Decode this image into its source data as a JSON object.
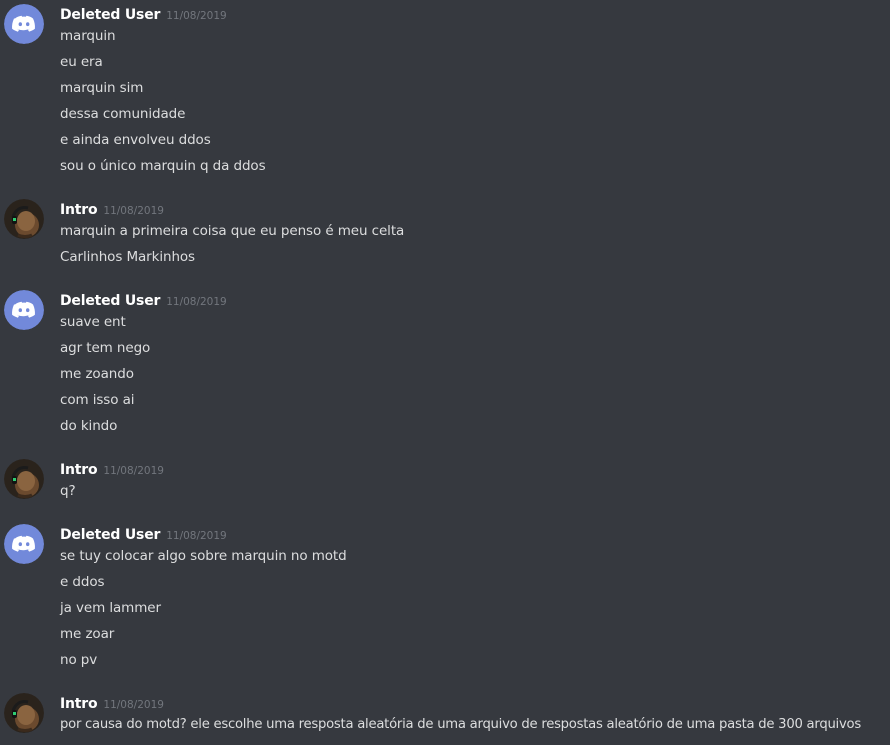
{
  "colors": {
    "background": "#36393f",
    "username": "#ffffff",
    "timestamp": "#72767d",
    "message_text": "#dcddde",
    "default_avatar": "#7289da"
  },
  "messages": [
    {
      "author": "Deleted User",
      "timestamp": "11/08/2019",
      "avatar_icon": "discord-default-avatar-icon",
      "lines": [
        "marquin",
        "eu era",
        "marquin sim",
        "dessa comunidade",
        "e ainda envolveu ddos",
        "sou o único marquin q da ddos"
      ]
    },
    {
      "author": "Intro",
      "timestamp": "11/08/2019",
      "avatar_icon": "user-photo-avatar",
      "lines": [
        "marquin a primeira coisa que eu penso é meu celta",
        "Carlinhos Markinhos"
      ]
    },
    {
      "author": "Deleted User",
      "timestamp": "11/08/2019",
      "avatar_icon": "discord-default-avatar-icon",
      "lines": [
        "suave ent",
        "agr tem nego",
        "me zoando",
        "com isso ai",
        "do kindo"
      ]
    },
    {
      "author": "Intro",
      "timestamp": "11/08/2019",
      "avatar_icon": "user-photo-avatar",
      "lines": [
        "q?"
      ]
    },
    {
      "author": "Deleted User",
      "timestamp": "11/08/2019",
      "avatar_icon": "discord-default-avatar-icon",
      "lines": [
        "se tuy colocar algo sobre marquin no motd",
        "e ddos",
        "ja vem lammer",
        "me zoar",
        "no pv"
      ]
    },
    {
      "author": "Intro",
      "timestamp": "11/08/2019",
      "avatar_icon": "user-photo-avatar",
      "lines": [
        "por causa do motd? ele escolhe uma resposta aleatória de uma arquivo de respostas aleatório de uma pasta de 300 arquivos"
      ]
    }
  ]
}
